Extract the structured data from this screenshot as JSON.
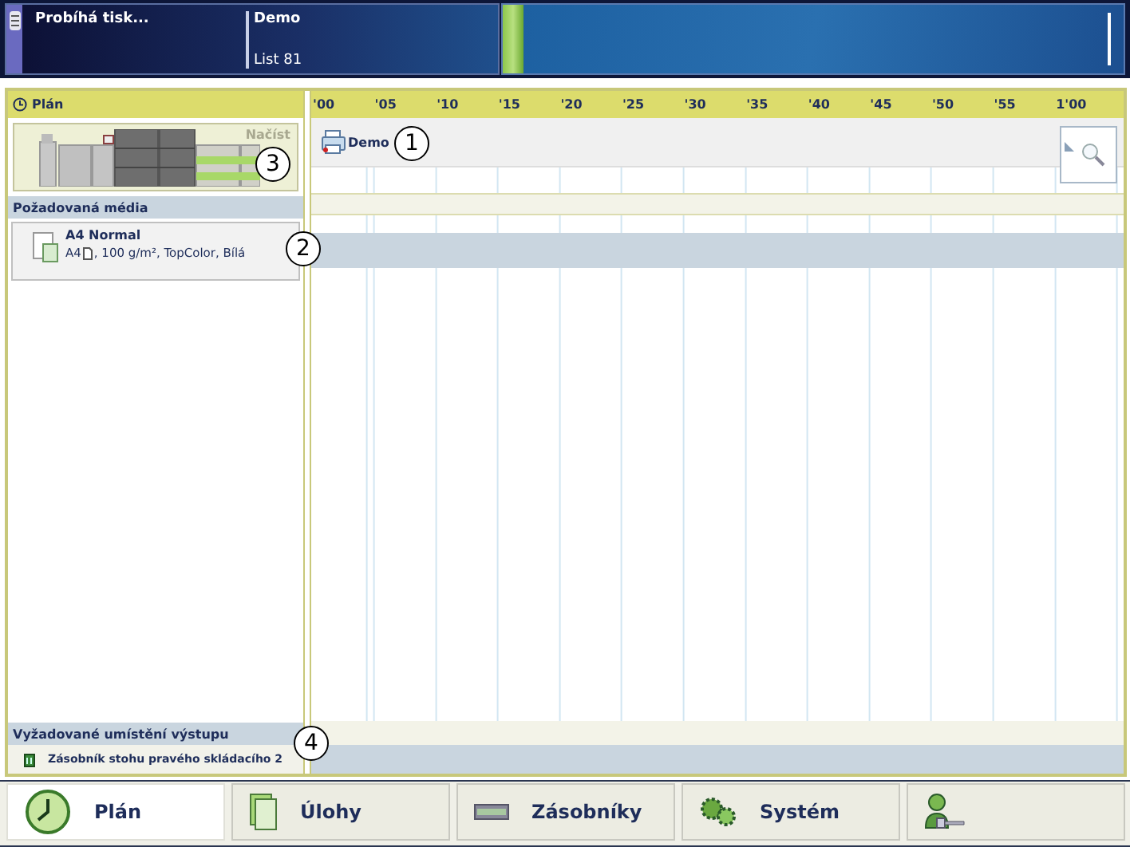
{
  "status_bar": {
    "state": "Probíhá tisk...",
    "job": "Demo",
    "sheet": "List 81"
  },
  "plan": {
    "title": "Plán",
    "printer_action": "Načíst",
    "media_header": "Požadovaná média",
    "media": [
      {
        "name": "A4 Normal",
        "size": "A4",
        "details": ", 100 g/m², TopColor, Bílá"
      }
    ],
    "output_header": "Vyžadované umístění výstupu",
    "output": [
      {
        "name": "Zásobník stohu pravého skládacího 2"
      }
    ]
  },
  "timeline": {
    "ticks": [
      "'00",
      "'05",
      "'10",
      "'15",
      "'20",
      "'25",
      "'30",
      "'35",
      "'40",
      "'45",
      "'50",
      "'55",
      "1'00"
    ],
    "jobs": [
      {
        "name": "Demo"
      }
    ]
  },
  "callouts": [
    "1",
    "2",
    "3",
    "4"
  ],
  "tabs": [
    {
      "label": "Plán",
      "kind": "clock",
      "selected": true
    },
    {
      "label": "Úlohy",
      "kind": "document",
      "selected": false
    },
    {
      "label": "Zásobníky",
      "kind": "tray",
      "selected": false
    },
    {
      "label": "Systém",
      "kind": "gears",
      "selected": false
    },
    {
      "kind": "user",
      "selected": false
    }
  ]
}
